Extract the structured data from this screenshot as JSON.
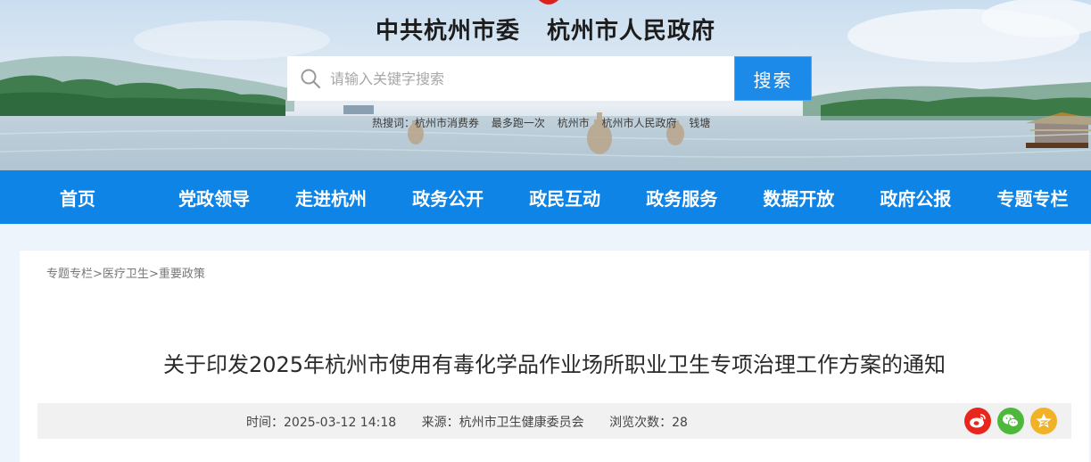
{
  "header": {
    "title_party": "中共杭州市委",
    "title_gov": "杭州市人民政府"
  },
  "search": {
    "placeholder": "请输入关键字搜索",
    "button_label": "搜索",
    "hot_label": "热搜词：",
    "hot_words": [
      "杭州市消费券",
      "最多跑一次",
      "杭州市",
      "杭州市人民政府",
      "钱塘"
    ]
  },
  "nav": {
    "items": [
      "首页",
      "党政领导",
      "走进杭州",
      "政务公开",
      "政民互动",
      "政务服务",
      "数据开放",
      "政府公报",
      "专题专栏"
    ]
  },
  "breadcrumb": {
    "items": [
      "专题专栏",
      "医疗卫生",
      "重要政策"
    ],
    "separator": ">"
  },
  "article": {
    "title": "关于印发2025年杭州市使用有毒化学品作业场所职业卫生专项治理工作方案的通知",
    "time_label": "时间：",
    "time": "2025-03-12 14:18",
    "source_label": "来源：",
    "source": "杭州市卫生健康委员会",
    "views_label": "浏览次数：",
    "views": "28"
  },
  "share": {
    "icons": [
      "weibo-icon",
      "wechat-icon",
      "qzone-icon"
    ]
  },
  "colors": {
    "nav_blue": "#0e84e6",
    "search_button": "#1b8ae8",
    "weibo": "#e8261c",
    "wechat": "#4cb93a",
    "qzone": "#f1b227"
  }
}
